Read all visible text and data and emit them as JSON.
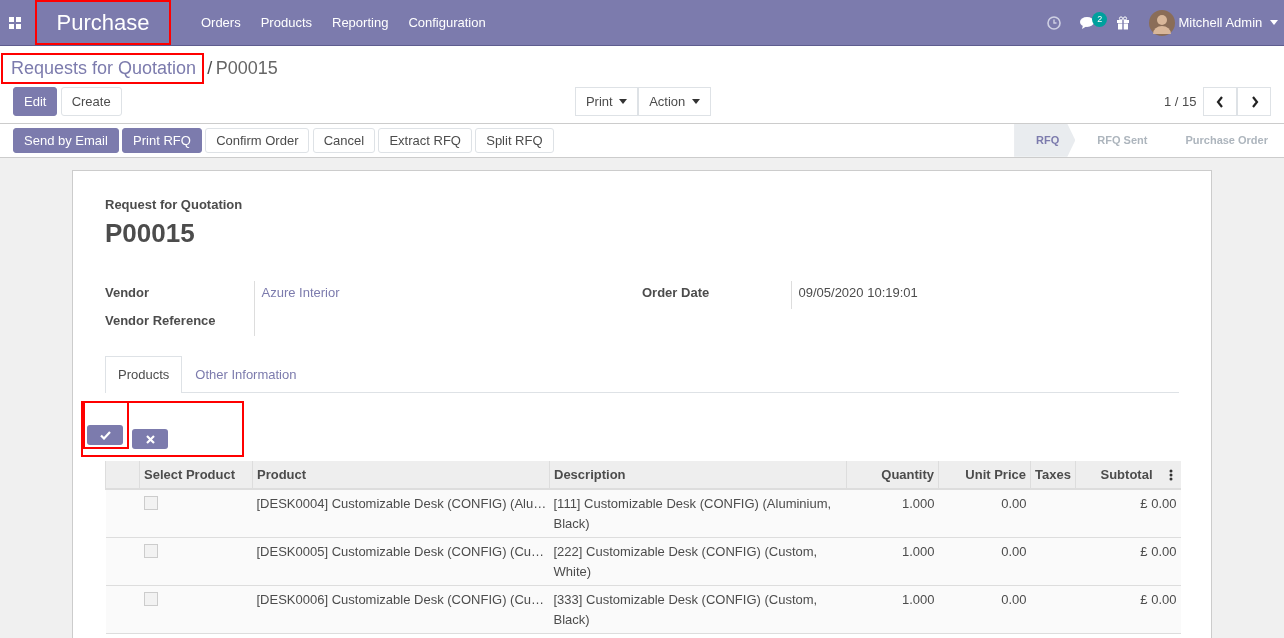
{
  "navbar": {
    "app_name": "Purchase",
    "app_name_highlighted": true,
    "menu": [
      "Orders",
      "Products",
      "Reporting",
      "Configuration"
    ],
    "messages_count": "2",
    "user_name": "Mitchell Admin"
  },
  "breadcrumb_separator": "/",
  "breadcrumb": [
    {
      "label": "Requests for Quotation",
      "highlighted": true
    },
    {
      "label": "P00015",
      "highlighted": false
    }
  ],
  "main_buttons": [
    {
      "label": "Edit",
      "primary": true
    },
    {
      "label": "Create",
      "primary": false
    }
  ],
  "dropdowns": [
    "Print",
    "Action"
  ],
  "pager": "1 / 15",
  "action_buttons": [
    {
      "label": "Send by Email",
      "primary": true
    },
    {
      "label": "Print RFQ",
      "primary": true
    },
    {
      "label": "Confirm Order",
      "primary": false
    },
    {
      "label": "Cancel",
      "primary": false
    },
    {
      "label": "Extract RFQ",
      "primary": false
    },
    {
      "label": "Split RFQ",
      "primary": false
    }
  ],
  "stages": [
    {
      "label": "RFQ",
      "selected": true
    },
    {
      "label": "RFQ Sent",
      "selected": false
    },
    {
      "label": "Purchase Order",
      "selected": false
    }
  ],
  "form": {
    "subtitle": "Request for Quotation",
    "name": "P00015",
    "left_fields": [
      {
        "label": "Vendor",
        "value": "Azure Interior"
      },
      {
        "label": "Vendor Reference"
      }
    ],
    "right_fields": [
      {
        "label": "Order Date",
        "value": "09/05/2020 10:19:01"
      }
    ],
    "tabs": [
      {
        "label": "Products",
        "selected": true
      },
      {
        "label": "Other Information",
        "selected": false
      }
    ],
    "line_buttons_highlighted": true,
    "confirm_button_highlighted": true,
    "table": {
      "columns": [
        "Select Product",
        "Product",
        "Description",
        "Quantity",
        "Unit Price",
        "Taxes",
        "Subtotal"
      ],
      "rows": [
        {
          "checked": false,
          "product": "[DESK0004] Customizable Desk (CONFIG) (Alu…",
          "description": "[111] Customizable Desk (CONFIG) (Aluminium, Black)",
          "quantity": "1.000",
          "unit_price": "0.00",
          "subtotal": "£ 0.00"
        },
        {
          "checked": false,
          "product": "[DESK0005] Customizable Desk (CONFIG) (Cu…",
          "description": "[222] Customizable Desk (CONFIG) (Custom, White)",
          "quantity": "1.000",
          "unit_price": "0.00",
          "subtotal": "£ 0.00"
        },
        {
          "checked": false,
          "product": "[DESK0006] Customizable Desk (CONFIG) (Cu…",
          "description": "[333] Customizable Desk (CONFIG) (Custom, Black)",
          "quantity": "1.000",
          "unit_price": "0.00",
          "subtotal": "£ 0.00"
        }
      ]
    }
  }
}
